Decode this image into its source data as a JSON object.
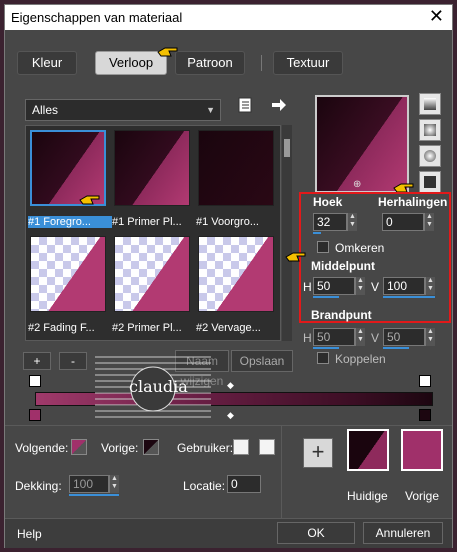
{
  "window": {
    "title": "Eigenschappen van materiaal",
    "close": "✕"
  },
  "tabs": [
    {
      "label": "Kleur",
      "active": false
    },
    {
      "label": "Verloop",
      "active": true
    },
    {
      "label": "Patroon",
      "active": false
    },
    {
      "label": "Textuur",
      "active": false
    }
  ],
  "category": {
    "value": "Alles"
  },
  "thumbnails": [
    {
      "caption": "#1 Foregro...",
      "selected": true
    },
    {
      "caption": "#1 Primer Pl...",
      "selected": false
    },
    {
      "caption": "#1 Voorgro...",
      "selected": false
    },
    {
      "caption": "#2 Fading F...",
      "selected": false
    },
    {
      "caption": "#2 Primer Pl...",
      "selected": false
    },
    {
      "caption": "#2 Vervage...",
      "selected": false
    }
  ],
  "settings": {
    "hoek_label": "Hoek",
    "hoek_value": "32",
    "herhalingen_label": "Herhalingen",
    "herhalingen_value": "0",
    "omkeren_label": "Omkeren",
    "middelpunt_label": "Middelpunt",
    "h_label": "H",
    "h_value": "50",
    "v_label": "V",
    "v_value": "100",
    "brandpunt_label": "Brandpunt",
    "bp_h_value": "50",
    "bp_v_value": "50",
    "koppelen_label": "Koppelen"
  },
  "editor": {
    "add": "+",
    "remove": "-",
    "rename": "Naam wijzigen",
    "save": "Opslaan"
  },
  "watermark": {
    "text": "claudia"
  },
  "bottom": {
    "volgende_label": "Volgende:",
    "vorige_label": "Vorige:",
    "gebruiker_label": "Gebruiker:",
    "dekking_label": "Dekking:",
    "dekking_value": "100",
    "locatie_label": "Locatie:",
    "locatie_value": "0",
    "plus": "+",
    "huidige_label": "Huidige",
    "vorige_swatch_label": "Vorige"
  },
  "footer": {
    "help": "Help",
    "ok": "OK",
    "cancel": "Annuleren"
  },
  "colors": {
    "accent": "#3a8fd8",
    "highlight_box": "#e2191a",
    "gradient_dark": "#1c0610",
    "gradient_pink": "#a0306a"
  }
}
